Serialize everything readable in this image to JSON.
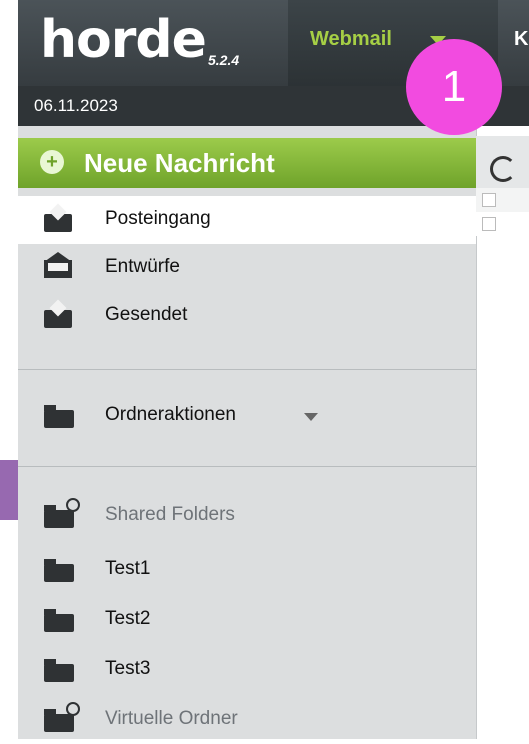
{
  "header": {
    "logo": "horde",
    "version": "5.2.4",
    "nav": {
      "webmail": "Webmail",
      "next": "K"
    },
    "date": "06.11.2023",
    "badge": "1"
  },
  "sidebar": {
    "compose_label": "Neue Nachricht",
    "mailboxes": [
      {
        "label": "Posteingang",
        "icon": "inbox-icon"
      },
      {
        "label": "Entwürfe",
        "icon": "drafts-icon"
      },
      {
        "label": "Gesendet",
        "icon": "sent-icon"
      }
    ],
    "folder_actions": "Ordneraktionen",
    "shared_folders": "Shared Folders",
    "folders": [
      "Test1",
      "Test2",
      "Test3"
    ],
    "virtual_folders": "Virtuelle Ordner"
  },
  "colors": {
    "accent_green": "#8cc63f",
    "badge_pink": "#f24be0",
    "topbar_dark": "#3a4043"
  }
}
